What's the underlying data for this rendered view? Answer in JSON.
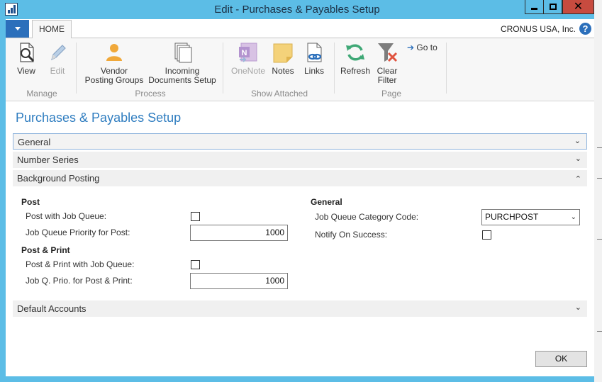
{
  "window": {
    "title": "Edit - Purchases & Payables Setup",
    "accent_color": "#5cbde6",
    "close_color": "#c74b3f"
  },
  "ribbon_tabs": {
    "home_label": "HOME",
    "company": "CRONUS USA, Inc."
  },
  "ribbon": {
    "groups": {
      "manage": "Manage",
      "process": "Process",
      "show_attached": "Show Attached",
      "page": "Page"
    },
    "buttons": {
      "view": "View",
      "edit": "Edit",
      "vendor_posting_groups_1": "Vendor",
      "vendor_posting_groups_2": "Posting Groups",
      "incoming_documents_setup_1": "Incoming",
      "incoming_documents_setup_2": "Documents Setup",
      "onenote": "OneNote",
      "notes": "Notes",
      "links": "Links",
      "refresh": "Refresh",
      "clear_filter_1": "Clear",
      "clear_filter_2": "Filter",
      "go_to": "Go to"
    }
  },
  "page": {
    "title": "Purchases & Payables Setup",
    "fasttabs": {
      "general": "General",
      "number_series": "Number Series",
      "background_posting": "Background Posting",
      "default_accounts": "Default Accounts"
    },
    "background_posting": {
      "post_header": "Post",
      "post_with_job_queue_label": "Post with Job Queue:",
      "post_with_job_queue_checked": false,
      "job_queue_priority_label": "Job Queue Priority for Post:",
      "job_queue_priority_value": "1000",
      "post_print_header": "Post & Print",
      "post_print_job_queue_label": "Post & Print with Job Queue:",
      "post_print_job_queue_checked": false,
      "job_q_prio_post_print_label": "Job Q. Prio. for Post & Print:",
      "job_q_prio_post_print_value": "1000",
      "general_header": "General",
      "job_queue_category_code_label": "Job Queue Category Code:",
      "job_queue_category_code_value": "PURCHPOST",
      "notify_on_success_label": "Notify On Success:",
      "notify_on_success_checked": false
    },
    "ok_label": "OK"
  }
}
